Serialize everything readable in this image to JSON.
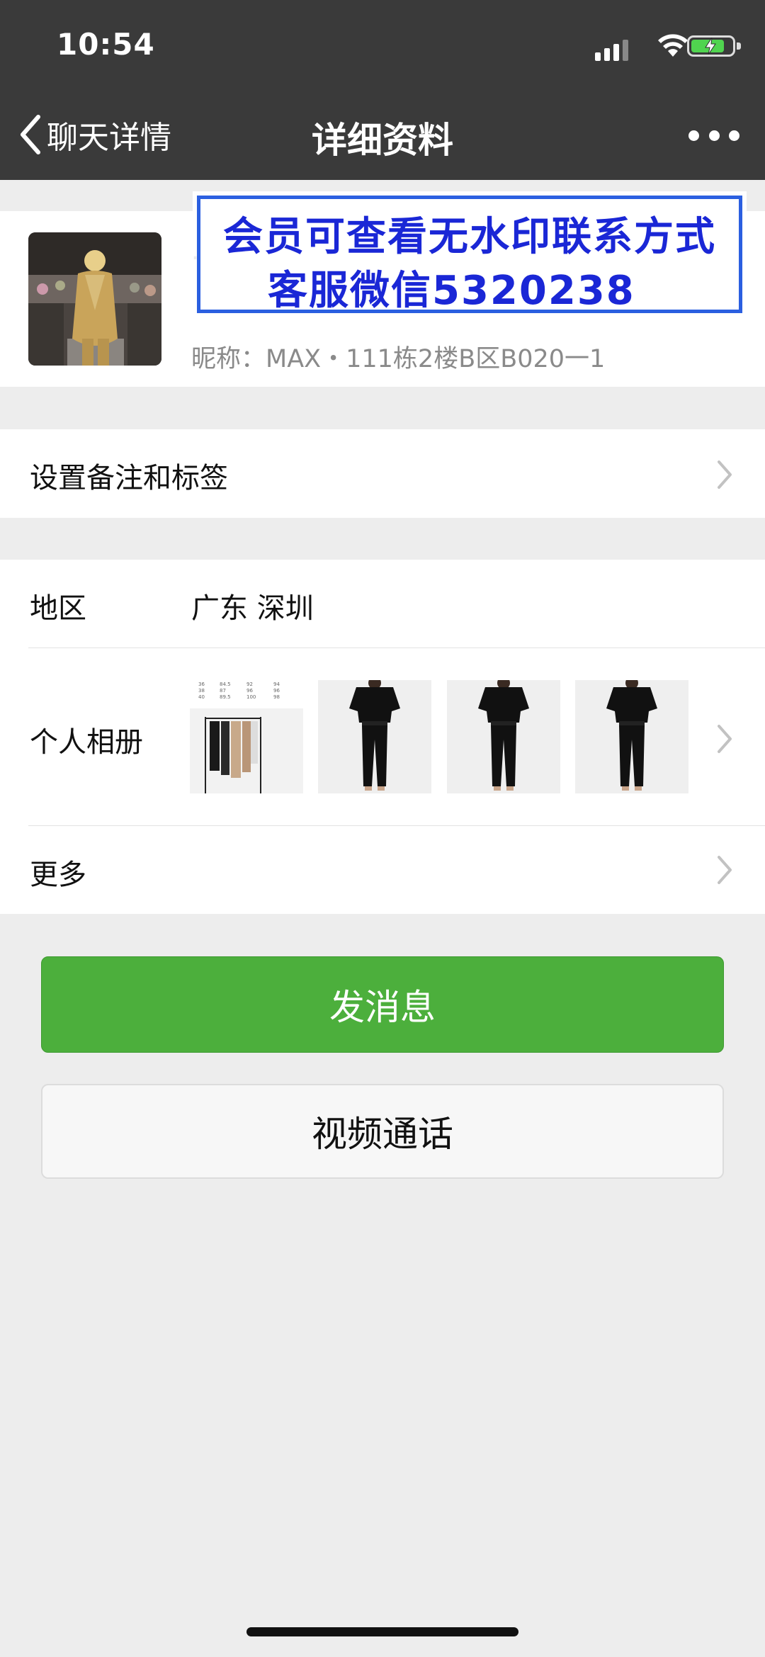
{
  "status_bar": {
    "time": "10:54"
  },
  "nav": {
    "back_label": "聊天详情",
    "title": "详细资料"
  },
  "profile": {
    "nickname": "昵称：MAX・111栋2楼B区B020一1"
  },
  "watermark": {
    "line1": "会员可查看无水印联系方式",
    "line2": "客服微信5320238"
  },
  "rows": {
    "remark_label": "设置备注和标签",
    "region_label": "地区",
    "region_value": "广东 深圳",
    "album_label": "个人相册",
    "more_label": "更多"
  },
  "album_thumbs": [
    {
      "name": "size-chart-rack-photo",
      "size_chart": [
        [
          "36",
          "84.5",
          "92",
          "94"
        ],
        [
          "38",
          "87",
          "96",
          "96"
        ],
        [
          "40",
          "89.5",
          "100",
          "98"
        ]
      ]
    },
    {
      "name": "black-jumpsuit-photo"
    },
    {
      "name": "black-jumpsuit-photo"
    },
    {
      "name": "black-jumpsuit-photo"
    }
  ],
  "buttons": {
    "send_message": "发消息",
    "video_call": "视频通话"
  },
  "colors": {
    "nav_bg": "#3A3A3A",
    "page_bg": "#EDEDED",
    "primary_green": "#4CAF3C",
    "watermark_blue": "#1A27D6"
  }
}
